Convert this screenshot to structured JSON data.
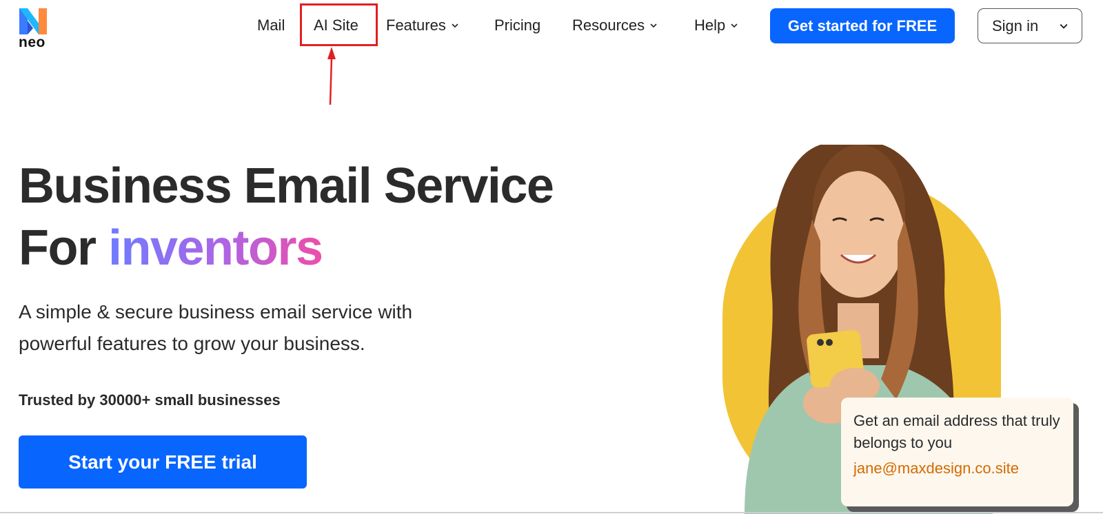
{
  "brand": {
    "logo_text": "neo",
    "accent": "#0866ff",
    "highlight": "#e02020"
  },
  "nav": {
    "items": [
      {
        "label": "Mail",
        "has_dropdown": false
      },
      {
        "label": "AI Site",
        "has_dropdown": false,
        "highlighted": true
      },
      {
        "label": "Features",
        "has_dropdown": true
      },
      {
        "label": "Pricing",
        "has_dropdown": false
      },
      {
        "label": "Resources",
        "has_dropdown": true
      },
      {
        "label": "Help",
        "has_dropdown": true
      }
    ],
    "cta_label": "Get started for FREE",
    "signin_label": "Sign in"
  },
  "hero": {
    "title_line1": "Business Email Service",
    "title_line2_prefix": "For ",
    "title_line2_highlight": "inventors",
    "subtitle": "A simple & secure business email service with powerful features to grow your business.",
    "trusted": "Trusted by 30000+ small businesses",
    "cta_label": "Start your FREE trial"
  },
  "promo_card": {
    "text": "Get an email address that truly belongs to you",
    "email": "jane@maxdesign.co.site",
    "email_color": "#d46a00"
  },
  "illustration": {
    "shape_color": "#f2c335"
  }
}
